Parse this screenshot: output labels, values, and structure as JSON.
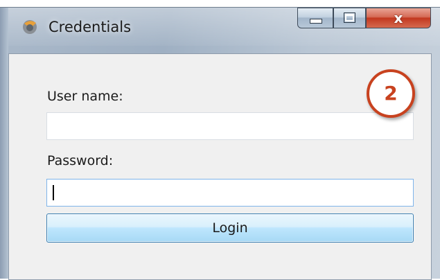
{
  "window": {
    "title": "Credentials",
    "controls": {
      "minimize": "",
      "maximize": "",
      "close": "x"
    }
  },
  "form": {
    "username_label": "User name:",
    "username_value": "",
    "password_label": "Password:",
    "password_value": "",
    "login_label": "Login"
  },
  "annotation": {
    "step_number": "2",
    "color": "#c8421f"
  },
  "colors": {
    "close_button": "#c2381f",
    "login_button_border": "#3c7fb1",
    "focused_field_border": "#7eb4ea"
  },
  "icons": [
    "app-icon",
    "minimize-icon",
    "maximize-icon",
    "close-icon"
  ]
}
